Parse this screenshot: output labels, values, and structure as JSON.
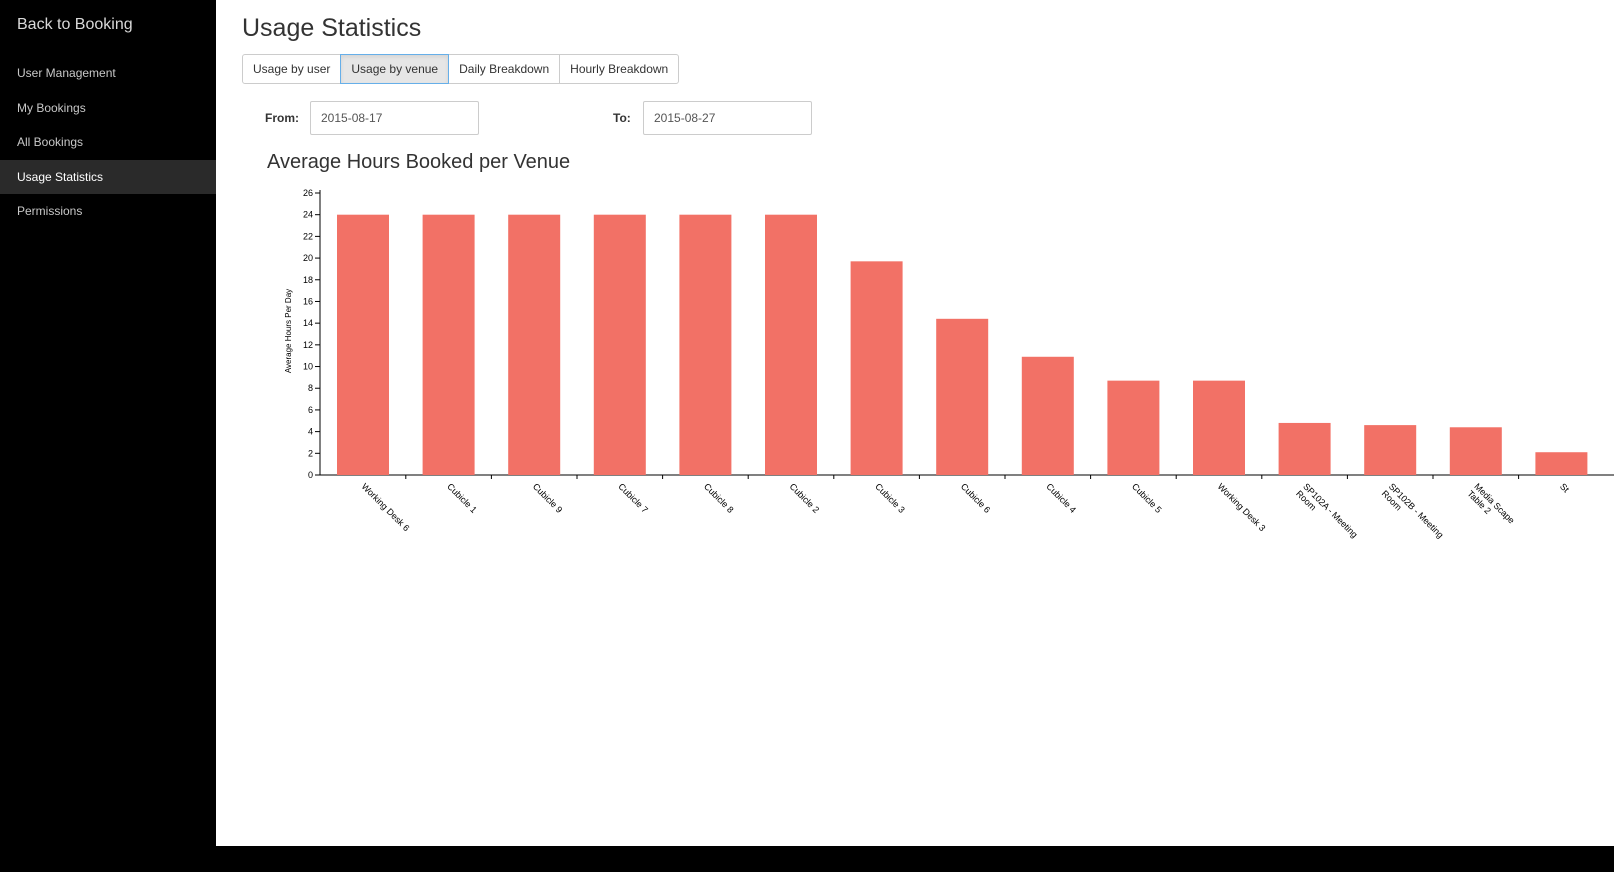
{
  "sidebar": {
    "brand": "Back to Booking",
    "items": [
      {
        "label": "User Management",
        "active": false
      },
      {
        "label": "My Bookings",
        "active": false
      },
      {
        "label": "All Bookings",
        "active": false
      },
      {
        "label": "Usage Statistics",
        "active": true
      },
      {
        "label": "Permissions",
        "active": false
      }
    ]
  },
  "page": {
    "title": "Usage Statistics",
    "tabs": [
      {
        "label": "Usage by user",
        "active": false
      },
      {
        "label": "Usage by venue",
        "active": true
      },
      {
        "label": "Daily Breakdown",
        "active": false
      },
      {
        "label": "Hourly Breakdown",
        "active": false
      }
    ],
    "from_label": "From:",
    "from_value": "2015-08-17",
    "to_label": "To:",
    "to_value": "2015-08-27"
  },
  "colors": {
    "bar": "#f27166",
    "sidebar_bg": "#000000",
    "sidebar_active": "#2a2a2a"
  },
  "chart_data": {
    "type": "bar",
    "title": "Average Hours Booked per Venue",
    "ylabel": "Average Hours Per Day",
    "xlabel": "",
    "ylim": [
      0,
      26
    ],
    "yticks": [
      0,
      2,
      4,
      6,
      8,
      10,
      12,
      14,
      16,
      18,
      20,
      22,
      24,
      26
    ],
    "categories": [
      "Working Desk 6",
      "Cubicle 1",
      "Cubicle 9",
      "Cubicle 7",
      "Cubicle 8",
      "Cubicle 2",
      "Cubicle 3",
      "Cubicle 6",
      "Cubicle 4",
      "Cubicle 5",
      "Working Desk 3",
      "SP102A - Meeting Room",
      "SP102B - Meeting Room",
      "Media Scape Table 2",
      "St"
    ],
    "values": [
      24,
      24,
      24,
      24,
      24,
      24,
      19.7,
      14.4,
      10.9,
      8.7,
      8.7,
      4.8,
      4.6,
      4.4,
      2.1
    ]
  }
}
